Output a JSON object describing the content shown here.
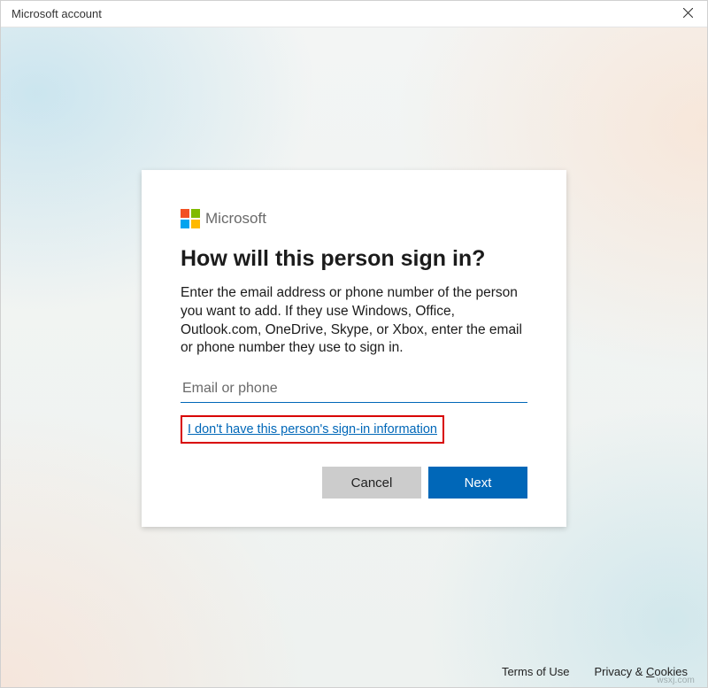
{
  "window": {
    "title": "Microsoft account"
  },
  "brand": {
    "name": "Microsoft"
  },
  "dialog": {
    "heading": "How will this person sign in?",
    "body": "Enter the email address or phone number of the person you want to add. If they use Windows, Office, Outlook.com, OneDrive, Skype, or Xbox, enter the email or phone number they use to sign in.",
    "input_placeholder": "Email or phone",
    "input_value": "",
    "no_info_link": "I don't have this person's sign-in information",
    "cancel": "Cancel",
    "next": "Next"
  },
  "footer": {
    "terms": "Terms of Use",
    "privacy_prefix": "Privacy & ",
    "privacy_key": "C",
    "privacy_suffix": "ookies"
  },
  "watermark": "wsxj.com",
  "colors": {
    "accent": "#0067b8",
    "highlight": "#d80000"
  }
}
